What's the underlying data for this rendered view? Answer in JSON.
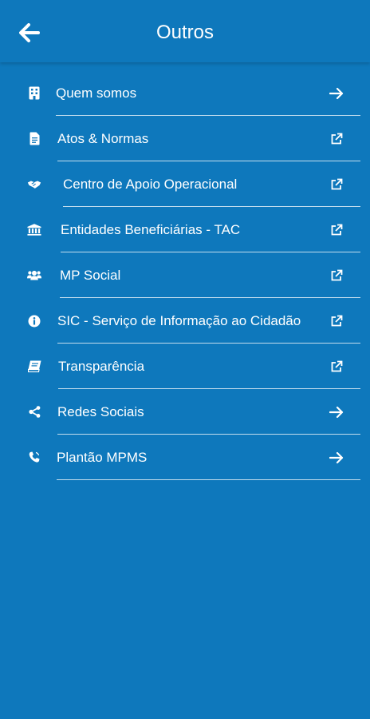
{
  "header": {
    "title": "Outros"
  },
  "menu": {
    "items": [
      {
        "label": "Quem somos",
        "icon": "building-icon",
        "trailing": "arrow-right-icon"
      },
      {
        "label": "Atos & Normas",
        "icon": "document-icon",
        "trailing": "external-link-icon"
      },
      {
        "label": "Centro de Apoio Operacional",
        "icon": "handshake-icon",
        "trailing": "external-link-icon"
      },
      {
        "label": "Entidades Beneficiárias - TAC",
        "icon": "bank-icon",
        "trailing": "external-link-icon"
      },
      {
        "label": "MP Social",
        "icon": "users-icon",
        "trailing": "external-link-icon"
      },
      {
        "label": "SIC - Serviço de Informação ao Cidadão",
        "icon": "info-icon",
        "trailing": "external-link-icon"
      },
      {
        "label": "Transparência",
        "icon": "book-icon",
        "trailing": "external-link-icon"
      },
      {
        "label": "Redes Sociais",
        "icon": "share-icon",
        "trailing": "arrow-right-icon"
      },
      {
        "label": "Plantão MPMS",
        "icon": "phone-icon",
        "trailing": "arrow-right-icon"
      }
    ]
  },
  "colors": {
    "background": "#0e78bc",
    "text": "#ffffff"
  }
}
